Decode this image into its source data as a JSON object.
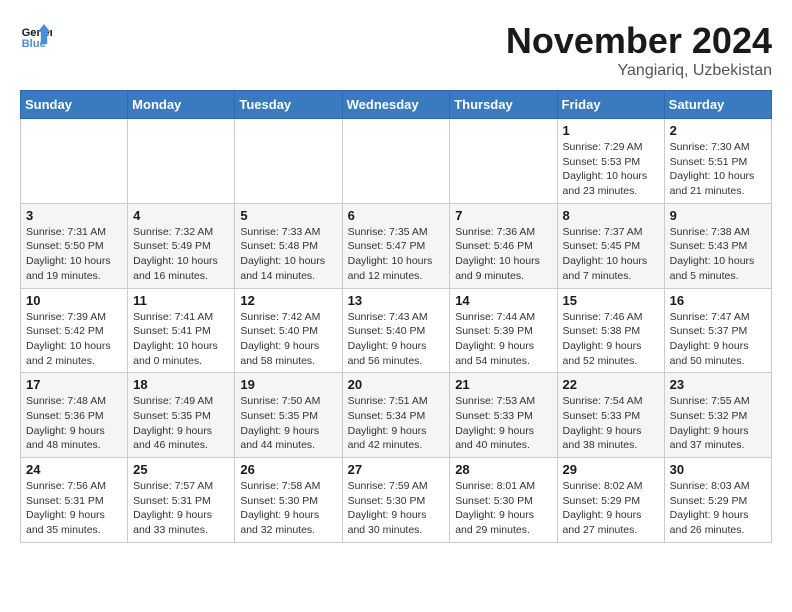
{
  "header": {
    "logo_line1": "General",
    "logo_line2": "Blue",
    "month_title": "November 2024",
    "location": "Yangiariq, Uzbekistan"
  },
  "weekdays": [
    "Sunday",
    "Monday",
    "Tuesday",
    "Wednesday",
    "Thursday",
    "Friday",
    "Saturday"
  ],
  "weeks": [
    [
      {
        "day": "",
        "info": ""
      },
      {
        "day": "",
        "info": ""
      },
      {
        "day": "",
        "info": ""
      },
      {
        "day": "",
        "info": ""
      },
      {
        "day": "",
        "info": ""
      },
      {
        "day": "1",
        "info": "Sunrise: 7:29 AM\nSunset: 5:53 PM\nDaylight: 10 hours and 23 minutes."
      },
      {
        "day": "2",
        "info": "Sunrise: 7:30 AM\nSunset: 5:51 PM\nDaylight: 10 hours and 21 minutes."
      }
    ],
    [
      {
        "day": "3",
        "info": "Sunrise: 7:31 AM\nSunset: 5:50 PM\nDaylight: 10 hours and 19 minutes."
      },
      {
        "day": "4",
        "info": "Sunrise: 7:32 AM\nSunset: 5:49 PM\nDaylight: 10 hours and 16 minutes."
      },
      {
        "day": "5",
        "info": "Sunrise: 7:33 AM\nSunset: 5:48 PM\nDaylight: 10 hours and 14 minutes."
      },
      {
        "day": "6",
        "info": "Sunrise: 7:35 AM\nSunset: 5:47 PM\nDaylight: 10 hours and 12 minutes."
      },
      {
        "day": "7",
        "info": "Sunrise: 7:36 AM\nSunset: 5:46 PM\nDaylight: 10 hours and 9 minutes."
      },
      {
        "day": "8",
        "info": "Sunrise: 7:37 AM\nSunset: 5:45 PM\nDaylight: 10 hours and 7 minutes."
      },
      {
        "day": "9",
        "info": "Sunrise: 7:38 AM\nSunset: 5:43 PM\nDaylight: 10 hours and 5 minutes."
      }
    ],
    [
      {
        "day": "10",
        "info": "Sunrise: 7:39 AM\nSunset: 5:42 PM\nDaylight: 10 hours and 2 minutes."
      },
      {
        "day": "11",
        "info": "Sunrise: 7:41 AM\nSunset: 5:41 PM\nDaylight: 10 hours and 0 minutes."
      },
      {
        "day": "12",
        "info": "Sunrise: 7:42 AM\nSunset: 5:40 PM\nDaylight: 9 hours and 58 minutes."
      },
      {
        "day": "13",
        "info": "Sunrise: 7:43 AM\nSunset: 5:40 PM\nDaylight: 9 hours and 56 minutes."
      },
      {
        "day": "14",
        "info": "Sunrise: 7:44 AM\nSunset: 5:39 PM\nDaylight: 9 hours and 54 minutes."
      },
      {
        "day": "15",
        "info": "Sunrise: 7:46 AM\nSunset: 5:38 PM\nDaylight: 9 hours and 52 minutes."
      },
      {
        "day": "16",
        "info": "Sunrise: 7:47 AM\nSunset: 5:37 PM\nDaylight: 9 hours and 50 minutes."
      }
    ],
    [
      {
        "day": "17",
        "info": "Sunrise: 7:48 AM\nSunset: 5:36 PM\nDaylight: 9 hours and 48 minutes."
      },
      {
        "day": "18",
        "info": "Sunrise: 7:49 AM\nSunset: 5:35 PM\nDaylight: 9 hours and 46 minutes."
      },
      {
        "day": "19",
        "info": "Sunrise: 7:50 AM\nSunset: 5:35 PM\nDaylight: 9 hours and 44 minutes."
      },
      {
        "day": "20",
        "info": "Sunrise: 7:51 AM\nSunset: 5:34 PM\nDaylight: 9 hours and 42 minutes."
      },
      {
        "day": "21",
        "info": "Sunrise: 7:53 AM\nSunset: 5:33 PM\nDaylight: 9 hours and 40 minutes."
      },
      {
        "day": "22",
        "info": "Sunrise: 7:54 AM\nSunset: 5:33 PM\nDaylight: 9 hours and 38 minutes."
      },
      {
        "day": "23",
        "info": "Sunrise: 7:55 AM\nSunset: 5:32 PM\nDaylight: 9 hours and 37 minutes."
      }
    ],
    [
      {
        "day": "24",
        "info": "Sunrise: 7:56 AM\nSunset: 5:31 PM\nDaylight: 9 hours and 35 minutes."
      },
      {
        "day": "25",
        "info": "Sunrise: 7:57 AM\nSunset: 5:31 PM\nDaylight: 9 hours and 33 minutes."
      },
      {
        "day": "26",
        "info": "Sunrise: 7:58 AM\nSunset: 5:30 PM\nDaylight: 9 hours and 32 minutes."
      },
      {
        "day": "27",
        "info": "Sunrise: 7:59 AM\nSunset: 5:30 PM\nDaylight: 9 hours and 30 minutes."
      },
      {
        "day": "28",
        "info": "Sunrise: 8:01 AM\nSunset: 5:30 PM\nDaylight: 9 hours and 29 minutes."
      },
      {
        "day": "29",
        "info": "Sunrise: 8:02 AM\nSunset: 5:29 PM\nDaylight: 9 hours and 27 minutes."
      },
      {
        "day": "30",
        "info": "Sunrise: 8:03 AM\nSunset: 5:29 PM\nDaylight: 9 hours and 26 minutes."
      }
    ]
  ]
}
